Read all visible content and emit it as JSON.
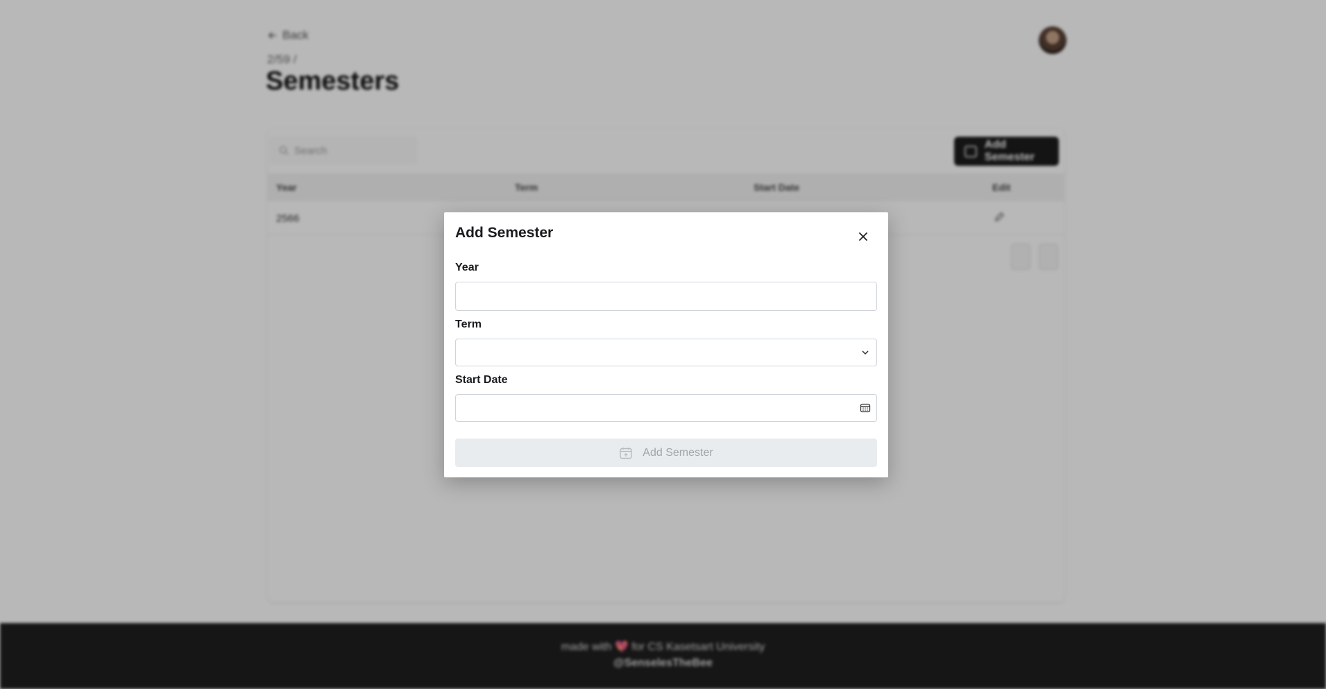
{
  "background": {
    "back_label": "Back",
    "breadcrumb": "2/59 /",
    "page_title": "Semesters",
    "search_placeholder": "Search",
    "add_button_label": "Add Semester",
    "table": {
      "headers": [
        "Year",
        "Term",
        "Start Date",
        "Edit"
      ],
      "rows": [
        {
          "year": "2566"
        }
      ]
    },
    "footer": {
      "line1": "made with 💖 for CS Kasetsart University",
      "line2": "@SenselesTheBee"
    }
  },
  "modal": {
    "title": "Add Semester",
    "year_label": "Year",
    "year_value": "",
    "term_label": "Term",
    "term_value": "",
    "start_date_label": "Start Date",
    "start_date_value": "",
    "submit_label": "Add Semester",
    "icons": {
      "close": "close-icon",
      "term_dropdown": "chevron-down-icon",
      "calendar": "calendar-icon",
      "submit": "calendar-plus-icon"
    }
  }
}
